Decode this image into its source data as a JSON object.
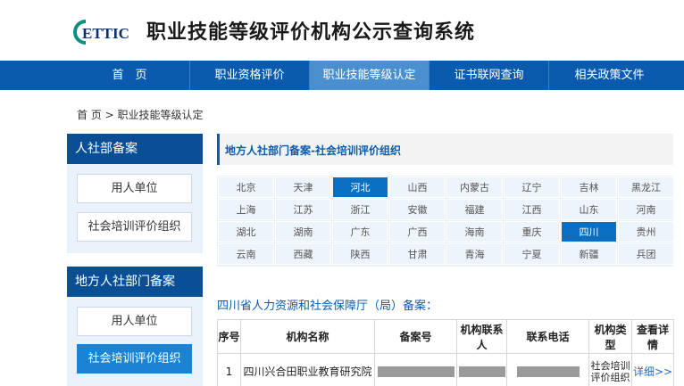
{
  "header": {
    "logo_text": "ETTIC",
    "title": "职业技能等级评价机构公示查询系统"
  },
  "nav": {
    "items": [
      {
        "label": "首　页"
      },
      {
        "label": "职业资格评价"
      },
      {
        "label": "职业技能等级认定"
      },
      {
        "label": "证书联网查询"
      },
      {
        "label": "相关政策文件"
      }
    ],
    "active_index": 2
  },
  "breadcrumb": "首 页 > 职业技能等级认定",
  "sidebar": {
    "box1": {
      "title": "人社部备案",
      "items": [
        {
          "label": "用人单位"
        },
        {
          "label": "社会培训评价组织"
        }
      ]
    },
    "box2": {
      "title": "地方人社部门备案",
      "items": [
        {
          "label": "用人单位"
        },
        {
          "label": "社会培训评价组织"
        }
      ],
      "active_index": 1
    }
  },
  "panel": {
    "title": "地方人社部门备案-社会培训评价组织"
  },
  "provinces": [
    [
      "北京",
      "天津",
      "河北",
      "山西",
      "内蒙古",
      "辽宁",
      "吉林",
      "黑龙江"
    ],
    [
      "上海",
      "江苏",
      "浙江",
      "安徽",
      "福建",
      "江西",
      "山东",
      "河南"
    ],
    [
      "湖北",
      "湖南",
      "广东",
      "广西",
      "海南",
      "重庆",
      "四川",
      "贵州"
    ],
    [
      "云南",
      "西藏",
      "陕西",
      "甘肃",
      "青海",
      "宁夏",
      "新疆",
      "兵团"
    ]
  ],
  "result": {
    "title": "四川省人力资源和社会保障厅（局）备案："
  },
  "table": {
    "headers": [
      "序号",
      "机构名称",
      "备案号",
      "机构联系人",
      "联系电话",
      "机构类型",
      "查看详情"
    ],
    "rows": [
      {
        "index": "1",
        "name": "四川兴合田职业教育研究院",
        "type": "社会培训评价组织",
        "detail": "详细>>"
      }
    ]
  },
  "colors": {
    "nav_bg": "#0a5bae",
    "nav_active": "#4a90cf",
    "sidebar_head": "#0a4f95",
    "province_active": "#0a6fc2",
    "link": "#1a6cc4"
  }
}
